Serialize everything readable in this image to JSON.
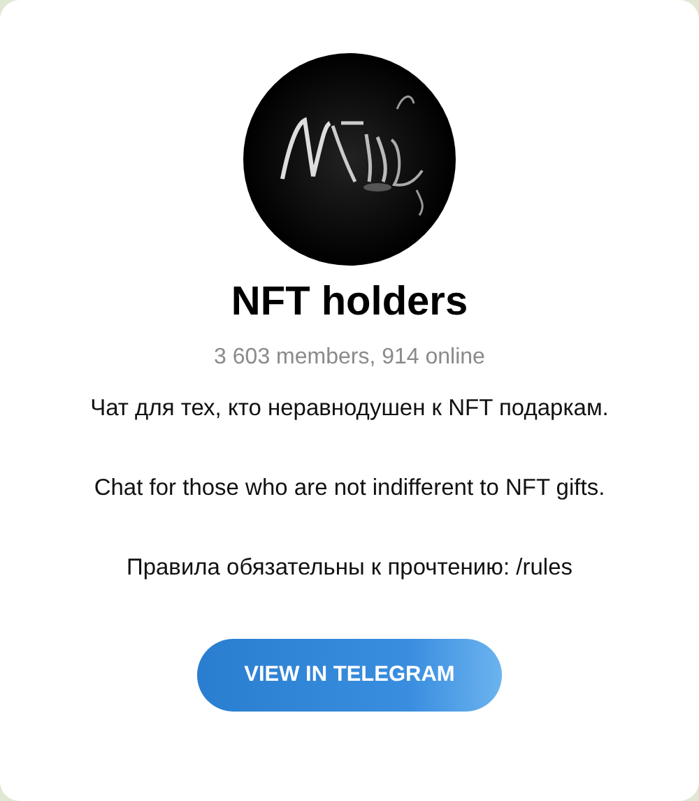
{
  "channel": {
    "title": "NFT holders",
    "stats": "3 603 members, 914 online",
    "description": [
      "Чат для тех, кто неравнодушен к NFT подаркам.",
      "Chat for those who are not indifferent to NFT gifts.",
      "Правила обязательны к прочтению: /rules"
    ],
    "button": "VIEW IN TELEGRAM"
  }
}
